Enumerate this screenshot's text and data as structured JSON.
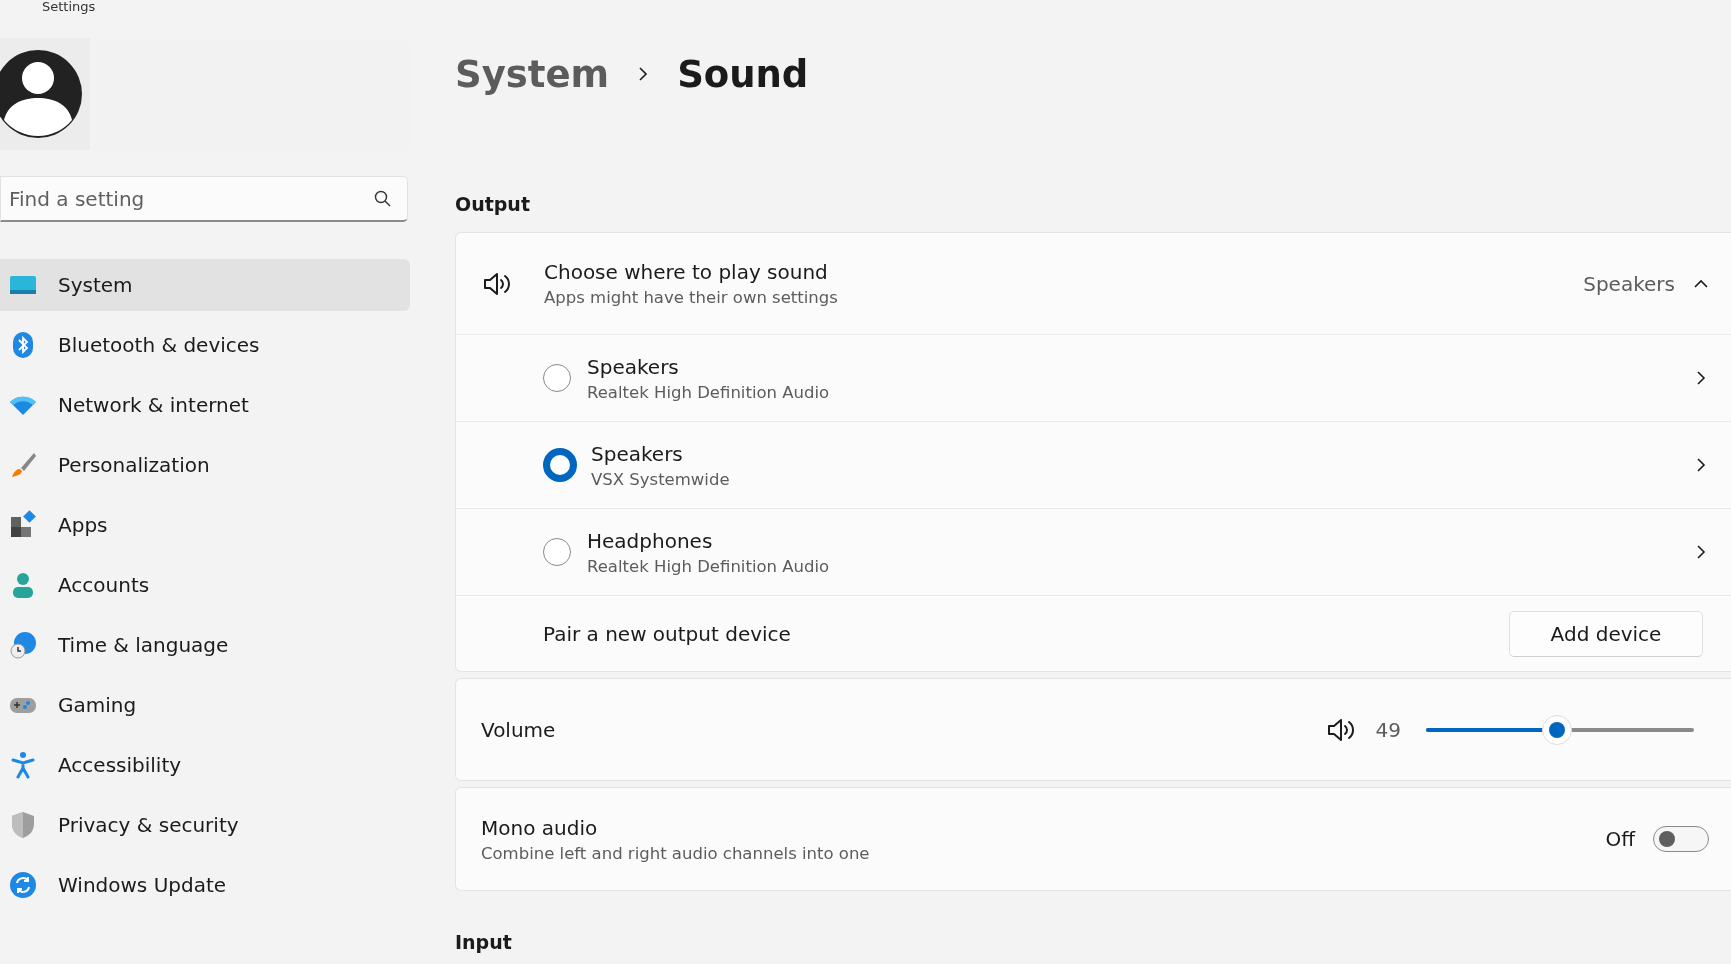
{
  "window": {
    "title": "Settings"
  },
  "search": {
    "placeholder": "Find a setting"
  },
  "sidebar": {
    "items": [
      {
        "label": "System",
        "kind": "system",
        "selected": true
      },
      {
        "label": "Bluetooth & devices",
        "kind": "bluetooth",
        "selected": false
      },
      {
        "label": "Network & internet",
        "kind": "wifi",
        "selected": false
      },
      {
        "label": "Personalization",
        "kind": "brush",
        "selected": false
      },
      {
        "label": "Apps",
        "kind": "apps",
        "selected": false
      },
      {
        "label": "Accounts",
        "kind": "person",
        "selected": false
      },
      {
        "label": "Time & language",
        "kind": "globe",
        "selected": false
      },
      {
        "label": "Gaming",
        "kind": "gamepad",
        "selected": false
      },
      {
        "label": "Accessibility",
        "kind": "accessibility",
        "selected": false
      },
      {
        "label": "Privacy & security",
        "kind": "shield",
        "selected": false
      },
      {
        "label": "Windows Update",
        "kind": "update",
        "selected": false
      }
    ]
  },
  "breadcrumb": [
    "System",
    "Sound"
  ],
  "output": {
    "heading": "Output",
    "choose": {
      "title": "Choose where to play sound",
      "subtitle": "Apps might have their own settings",
      "value": "Speakers",
      "expanded": true
    },
    "devices": [
      {
        "name": "Speakers",
        "detail": "Realtek High Definition Audio",
        "selected": false
      },
      {
        "name": "Speakers",
        "detail": "VSX Systemwide",
        "selected": true
      },
      {
        "name": "Headphones",
        "detail": "Realtek High Definition Audio",
        "selected": false
      }
    ],
    "pair": {
      "label": "Pair a new output device",
      "button": "Add device"
    },
    "volume": {
      "label": "Volume",
      "reading": "49",
      "level": 0.49
    },
    "mono": {
      "title": "Mono audio",
      "subtitle": "Combine left and right audio channels into one",
      "state": "Off",
      "on": false
    }
  },
  "input": {
    "heading": "Input"
  }
}
